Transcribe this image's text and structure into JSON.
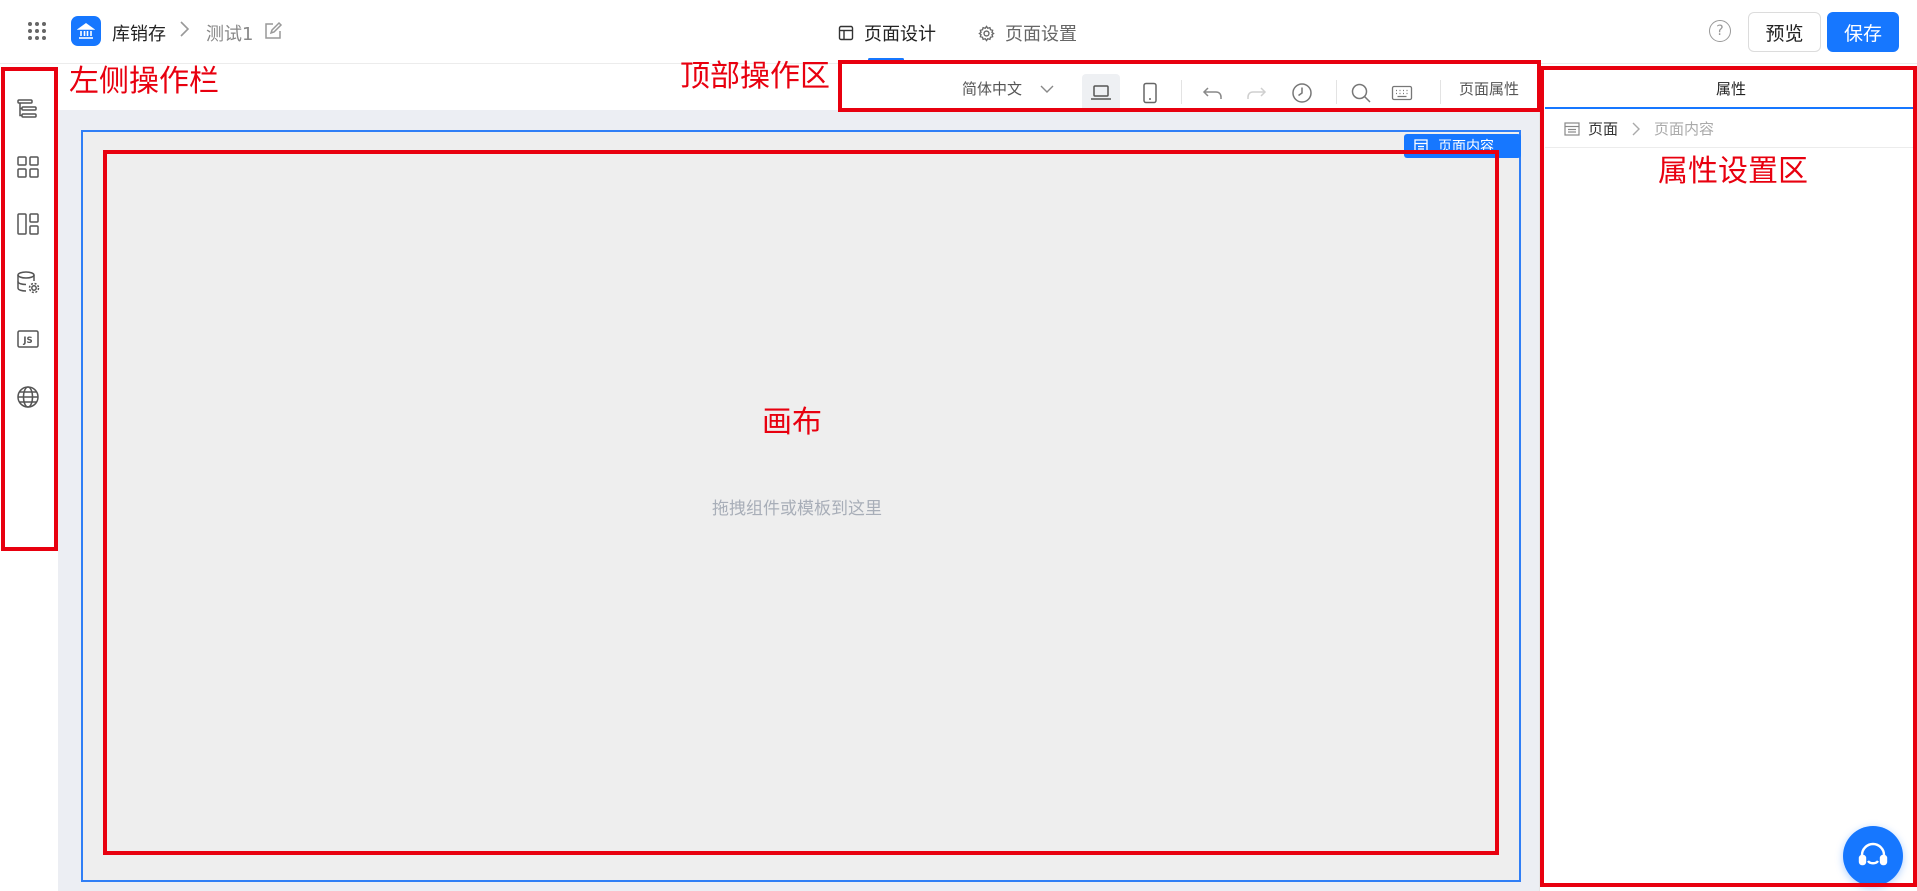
{
  "header": {
    "app_name": "库销存",
    "breadcrumb_sep": ">",
    "page_name": "测试1",
    "tabs": [
      {
        "label": "页面设计",
        "active": true
      },
      {
        "label": "页面设置",
        "active": false
      }
    ],
    "help": "?",
    "preview_label": "预览",
    "save_label": "保存"
  },
  "left_bar": {
    "icons": [
      "outline-tree-icon",
      "components-grid-icon",
      "layout-template-icon",
      "datasource-settings-icon",
      "js-code-icon",
      "globe-i18n-icon"
    ]
  },
  "toolbar": {
    "language": "简体中文",
    "page_properties": "页面属性"
  },
  "canvas": {
    "badge": "页面内容",
    "hint": "拖拽组件或模板到这里"
  },
  "right_panel": {
    "tab": "属性",
    "breadcrumb": [
      "页面",
      "页面内容"
    ]
  },
  "annotations": {
    "left": "左侧操作栏",
    "top": "顶部操作区",
    "canvas": "画布",
    "props": "属性设置区"
  },
  "colors": {
    "accent": "#1677ff",
    "annotation": "#e8000f",
    "canvas_bg": "#eeeeee",
    "workspace_bg": "#eceef3"
  }
}
